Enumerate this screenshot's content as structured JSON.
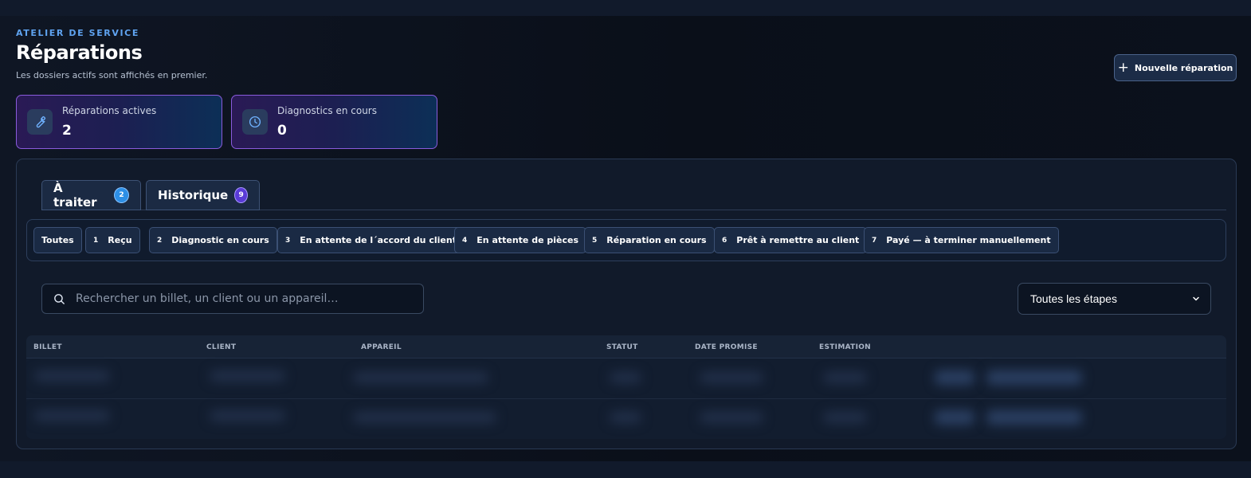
{
  "header": {
    "eyebrow": "ATELIER DE SERVICE",
    "title": "Réparations",
    "subtitle": "Les dossiers actifs sont affichés en premier.",
    "new_button_label": "Nouvelle réparation"
  },
  "stats": [
    {
      "label": "Réparations actives",
      "value": "2",
      "icon": "wrench-icon"
    },
    {
      "label": "Diagnostics en cours",
      "value": "0",
      "icon": "clock-icon"
    }
  ],
  "tabs": [
    {
      "label": "À traiter",
      "count": "2"
    },
    {
      "label": "Historique",
      "count": "9"
    }
  ],
  "filters": [
    {
      "num": "",
      "label": "Toutes"
    },
    {
      "num": "1",
      "label": "Reçu"
    },
    {
      "num": "2",
      "label": "Diagnostic en cours"
    },
    {
      "num": "3",
      "label": "En attente de l´accord du client"
    },
    {
      "num": "4",
      "label": "En attente de pièces"
    },
    {
      "num": "5",
      "label": "Réparation en cours"
    },
    {
      "num": "6",
      "label": "Prêt à remettre au client"
    },
    {
      "num": "7",
      "label": "Payé — à terminer manuellement"
    }
  ],
  "search": {
    "placeholder": "Rechercher un billet, un client ou un appareil…"
  },
  "stage_select": {
    "selected": "Toutes les étapes"
  },
  "table": {
    "columns": [
      "BILLET",
      "CLIENT",
      "APPAREIL",
      "STATUT",
      "DATE PROMISE",
      "ESTIMATION"
    ]
  },
  "colors": {
    "accent": "#5fa3f0",
    "stat_border": "#8a5bdc",
    "badge_blue": "#2d8fe6",
    "badge_purple": "#5a3bd6"
  }
}
